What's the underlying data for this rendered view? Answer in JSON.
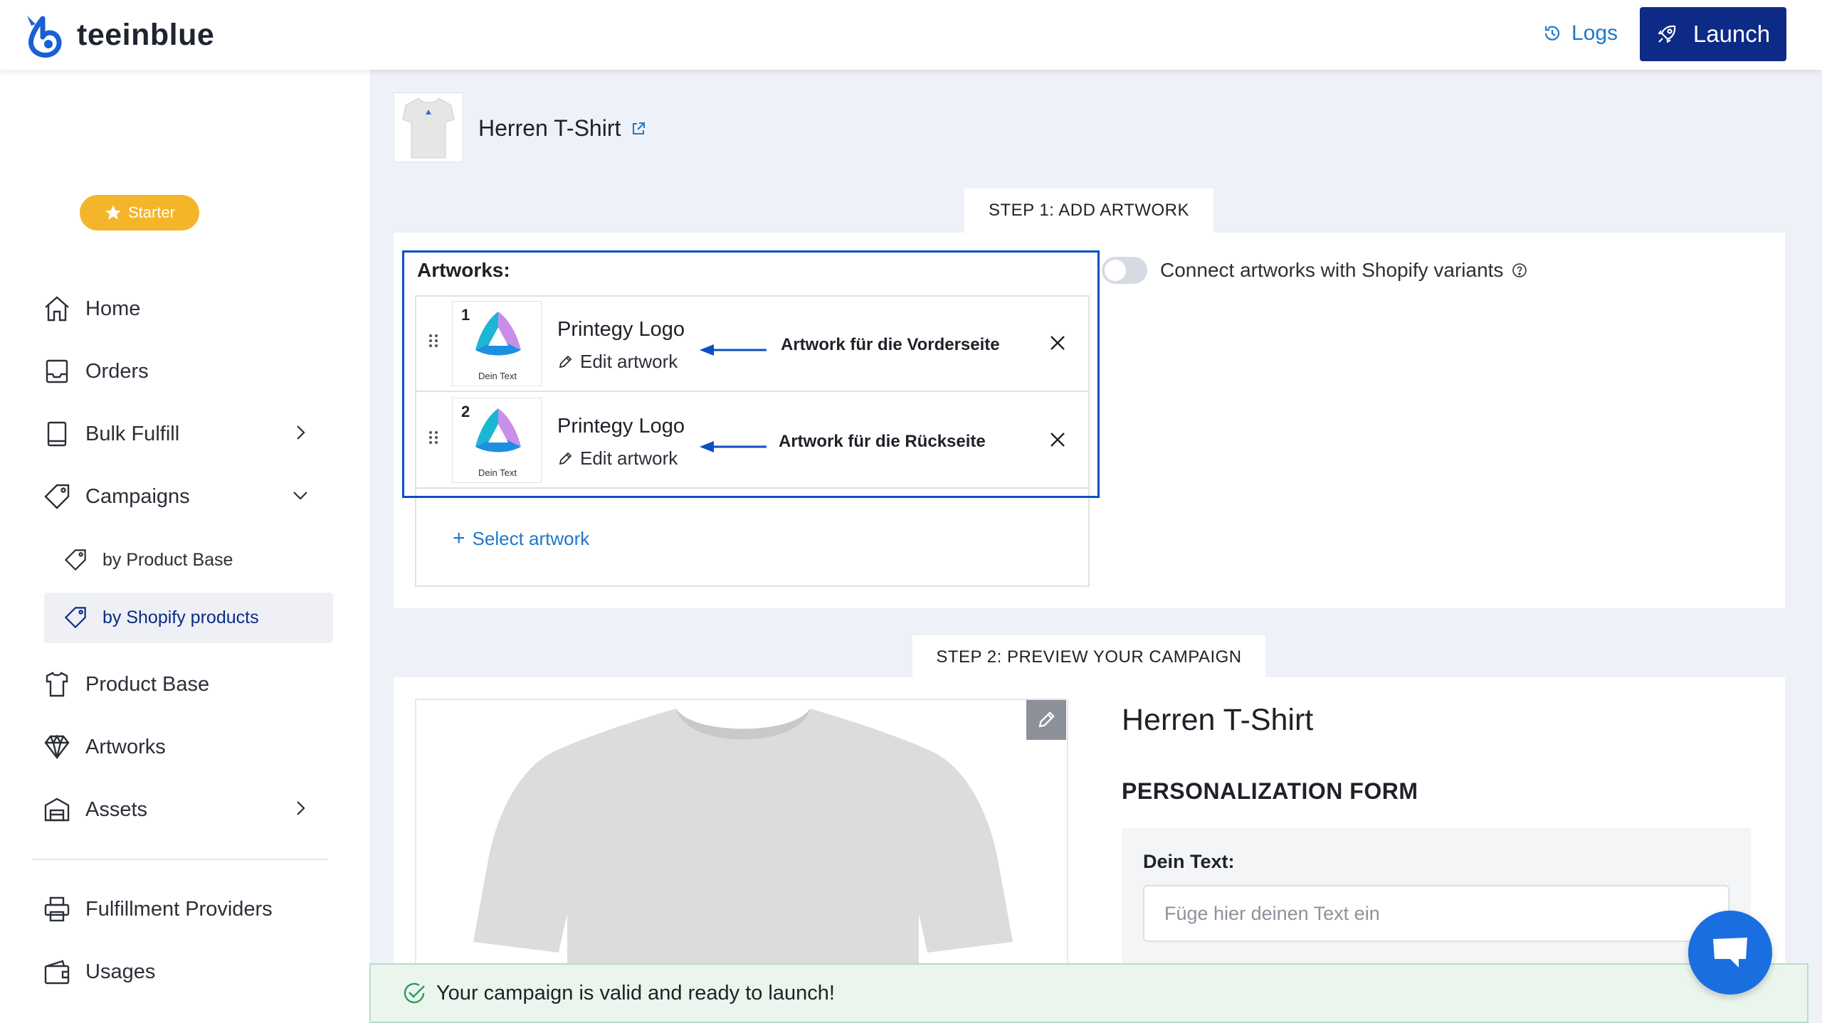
{
  "app": {
    "name": "teeinblue"
  },
  "header": {
    "logs_label": "Logs",
    "launch_label": "Launch"
  },
  "sidebar": {
    "plan_badge": "Starter",
    "items": {
      "home": "Home",
      "orders": "Orders",
      "bulk_fulfill": "Bulk Fulfill",
      "campaigns": "Campaigns",
      "by_product_base": "by Product Base",
      "by_shopify_products": "by Shopify products",
      "product_base": "Product Base",
      "artworks": "Artworks",
      "assets": "Assets",
      "fulfillment_providers": "Fulfillment Providers",
      "usages": "Usages"
    },
    "active_item": "by Shopify products"
  },
  "product": {
    "title": "Herren T-Shirt"
  },
  "step1": {
    "label": "STEP 1: ADD ARTWORK",
    "artworks_label": "Artworks:",
    "artworks": [
      {
        "number": "1",
        "name": "Printegy Logo",
        "edit_label": "Edit artwork",
        "thumb_caption": "Dein Text",
        "annotation": "Artwork für die Vorderseite"
      },
      {
        "number": "2",
        "name": "Printegy Logo",
        "edit_label": "Edit artwork",
        "thumb_caption": "Dein Text",
        "annotation": "Artwork für die Rückseite"
      }
    ],
    "select_artwork_label": "Select artwork",
    "connect_toggle_label": "Connect artworks with Shopify variants",
    "connect_toggle_on": false
  },
  "step2": {
    "label": "STEP 2: PREVIEW YOUR CAMPAIGN",
    "preview_title": "Herren T-Shirt",
    "form_heading": "PERSONALIZATION FORM",
    "field_label": "Dein Text:",
    "field_placeholder": "Füge hier deinen Text ein",
    "field_value": ""
  },
  "status": {
    "message": "Your campaign is valid and ready to launch!"
  },
  "colors": {
    "accent": "#0d2a86",
    "link": "#1f78c8",
    "annotation_blue": "#0c4fc4",
    "badge": "#f5b52a",
    "success_bg": "#eaf5ee",
    "chat": "#1a6fe0"
  }
}
